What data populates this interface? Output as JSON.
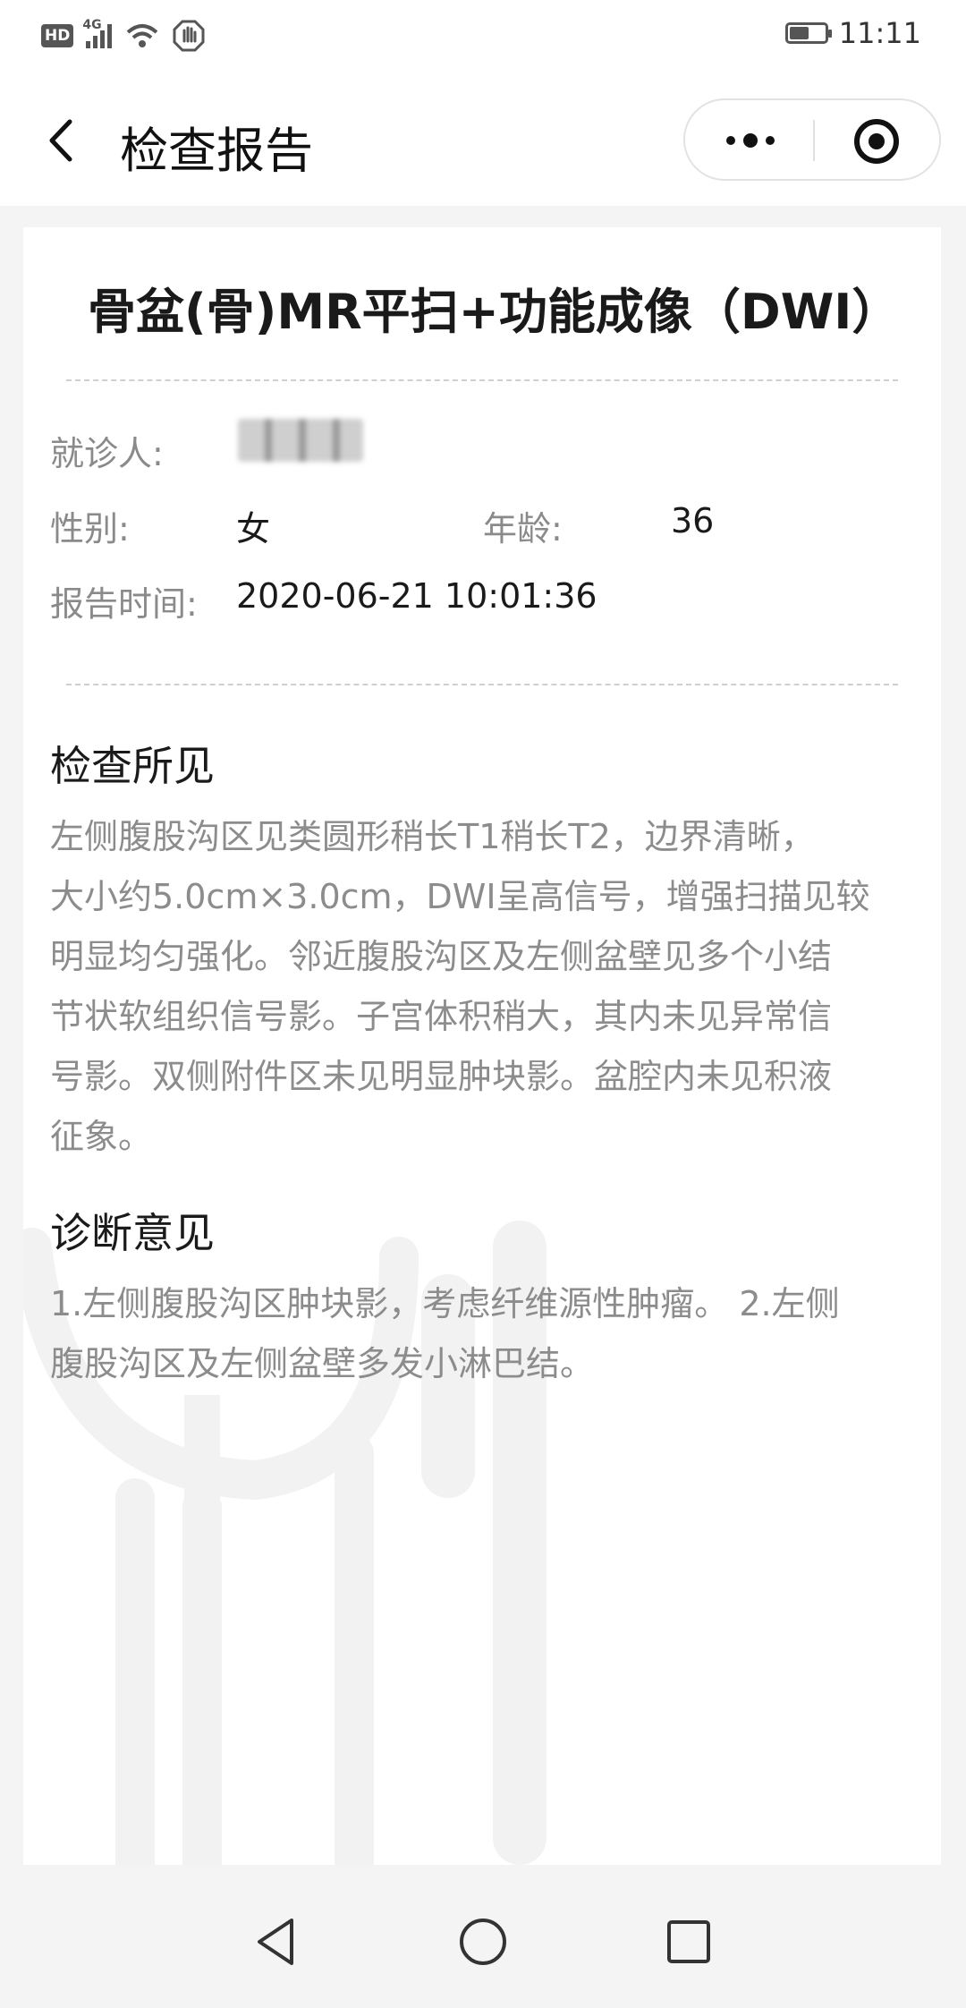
{
  "status_bar": {
    "hd": "HD",
    "network": "4G",
    "time": "11:11",
    "battery_level": 0.55,
    "icons": [
      "hd-icon",
      "signal-icon",
      "wifi-icon",
      "hand-icon",
      "battery-icon"
    ]
  },
  "header": {
    "title": "检查报告",
    "icons": [
      "back-arrow-icon",
      "more-dots-icon",
      "close-target-icon"
    ]
  },
  "report": {
    "title": "骨盆(骨)MR平扫+功能成像（DWI）",
    "patient_label": "就诊人:",
    "gender_label": "性别:",
    "gender_value": "女",
    "age_label": "年龄:",
    "age_value": "36",
    "report_time_label": "报告时间:",
    "report_time_value": "2020-06-21 10:01:36"
  },
  "findings": {
    "title": "检查所见",
    "lines": [
      "左侧腹股沟区见类圆形稍长T1稍长T2，边界清晰，",
      "大小约5.0cm×3.0cm，DWI呈高信号，增强扫描见较",
      "明显均匀强化。邻近腹股沟区及左侧盆壁见多个小结",
      "节状软组织信号影。子宫体积稍大，其内未见异常信",
      "号影。双侧附件区未见明显肿块影。盆腔内未见积液",
      "征象。"
    ]
  },
  "diagnosis": {
    "title": "诊断意见",
    "lines": [
      "1.左侧腹股沟区肿块影，考虑纤维源性肿瘤。 2.左侧",
      "腹股沟区及左侧盆壁多发小淋巴结。"
    ]
  },
  "nav": {
    "icons": [
      "nav-back-icon",
      "nav-home-icon",
      "nav-recents-icon"
    ]
  },
  "colors": {
    "background": "#f4f4f4",
    "card": "#ffffff",
    "label": "#8a8a8a",
    "text": "#1a1a1a",
    "body_text": "#8c8c8c"
  }
}
